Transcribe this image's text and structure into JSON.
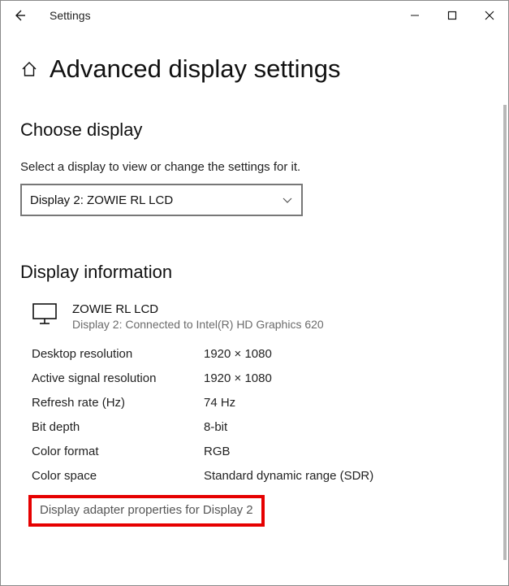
{
  "titlebar": {
    "title": "Settings"
  },
  "page": {
    "heading": "Advanced display settings"
  },
  "choose": {
    "heading": "Choose display",
    "helper": "Select a display to view or change the settings for it.",
    "selected": "Display 2: ZOWIE RL LCD"
  },
  "info": {
    "heading": "Display information",
    "monitor_name": "ZOWIE RL LCD",
    "monitor_sub": "Display 2: Connected to Intel(R) HD Graphics 620",
    "rows": [
      {
        "k": "Desktop resolution",
        "v": "1920 × 1080"
      },
      {
        "k": "Active signal resolution",
        "v": "1920 × 1080"
      },
      {
        "k": "Refresh rate (Hz)",
        "v": "74 Hz"
      },
      {
        "k": "Bit depth",
        "v": "8-bit"
      },
      {
        "k": "Color format",
        "v": "RGB"
      },
      {
        "k": "Color space",
        "v": "Standard dynamic range (SDR)"
      }
    ],
    "adapter_link": "Display adapter properties for Display 2"
  }
}
